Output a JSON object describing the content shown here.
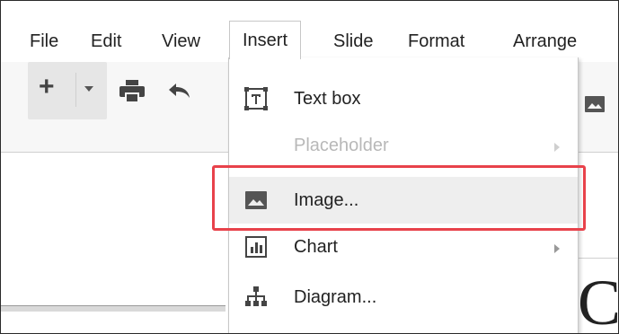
{
  "menubar": {
    "items": [
      {
        "label": "File"
      },
      {
        "label": "Edit"
      },
      {
        "label": "View"
      },
      {
        "label": "Insert"
      },
      {
        "label": "Slide"
      },
      {
        "label": "Format"
      },
      {
        "label": "Arrange"
      }
    ],
    "active": "Insert"
  },
  "toolbar": {
    "icons": [
      "plus-icon",
      "chevron-down-icon",
      "print-icon",
      "undo-icon",
      "image-icon"
    ]
  },
  "insert_menu": {
    "items": [
      {
        "label": "Text box",
        "icon": "text-box-icon",
        "enabled": true,
        "submenu": false
      },
      {
        "label": "Placeholder",
        "icon": "",
        "enabled": false,
        "submenu": true
      },
      {
        "label": "Image...",
        "icon": "image-icon",
        "enabled": true,
        "submenu": false,
        "highlighted": true
      },
      {
        "label": "Chart",
        "icon": "chart-icon",
        "enabled": true,
        "submenu": true
      },
      {
        "label": "Diagram...",
        "icon": "diagram-icon",
        "enabled": true,
        "submenu": false
      }
    ]
  },
  "slide": {
    "visible_text": "C"
  },
  "colors": {
    "callout_border": "#e8424b",
    "menu_highlight": "#eeeeee",
    "disabled_text": "#b8b8b8"
  }
}
